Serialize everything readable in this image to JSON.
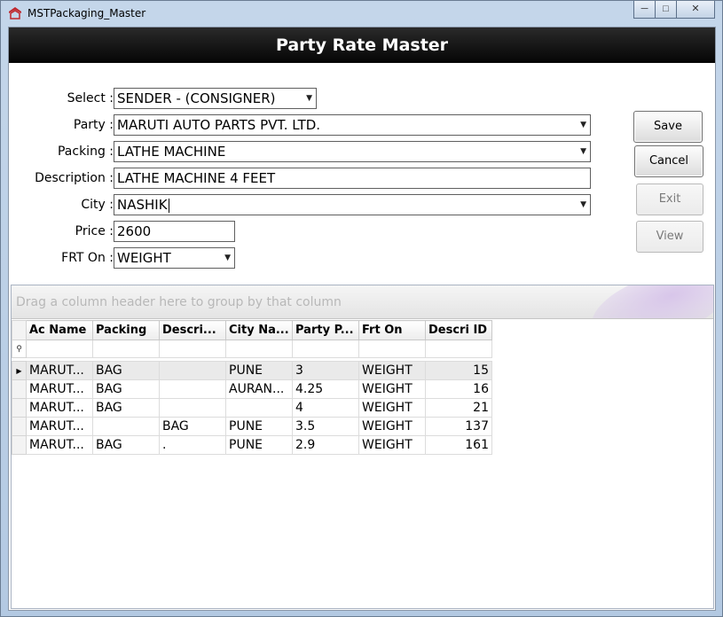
{
  "window": {
    "title": "MSTPackaging_Master",
    "controls": {
      "minimize": "─",
      "maximize": "□",
      "close": "✕"
    }
  },
  "header": {
    "title": "Party Rate Master"
  },
  "form": {
    "select": {
      "label": "Select :",
      "value": "SENDER - (CONSIGNER)"
    },
    "party": {
      "label": "Party :",
      "value": "MARUTI AUTO PARTS PVT. LTD."
    },
    "packing": {
      "label": "Packing :",
      "value": "LATHE MACHINE"
    },
    "description": {
      "label": "Description :",
      "value": "LATHE MACHINE 4 FEET"
    },
    "city": {
      "label": "City :",
      "value": "NASHIK"
    },
    "price": {
      "label": "Price :",
      "value": "2600"
    },
    "frt_on": {
      "label": "FRT On :",
      "value": "WEIGHT"
    }
  },
  "buttons": {
    "save": "Save",
    "cancel": "Cancel",
    "exit": "Exit",
    "view": "View"
  },
  "grid": {
    "group_hint": "Drag a column header here to group by that column",
    "columns": [
      "Ac Name",
      "Packing",
      "Descri...",
      "City Na...",
      "Party P...",
      "Frt On",
      "Descri ID"
    ],
    "rows": [
      [
        "MARUT...",
        "BAG",
        "",
        "PUNE",
        "3",
        "WEIGHT",
        "15"
      ],
      [
        "MARUT...",
        "BAG",
        "",
        "AURAN...",
        "4.25",
        "WEIGHT",
        "16"
      ],
      [
        "MARUT...",
        "BAG",
        "",
        "",
        "4",
        "WEIGHT",
        "21"
      ],
      [
        "MARUT...",
        "",
        "BAG",
        "PUNE",
        "3.5",
        "WEIGHT",
        "137"
      ],
      [
        "MARUT...",
        "BAG",
        ".",
        "PUNE",
        "2.9",
        "WEIGHT",
        "161"
      ]
    ]
  },
  "colors": {
    "header_band": "#111111",
    "window_frame": "#b8cce4"
  }
}
